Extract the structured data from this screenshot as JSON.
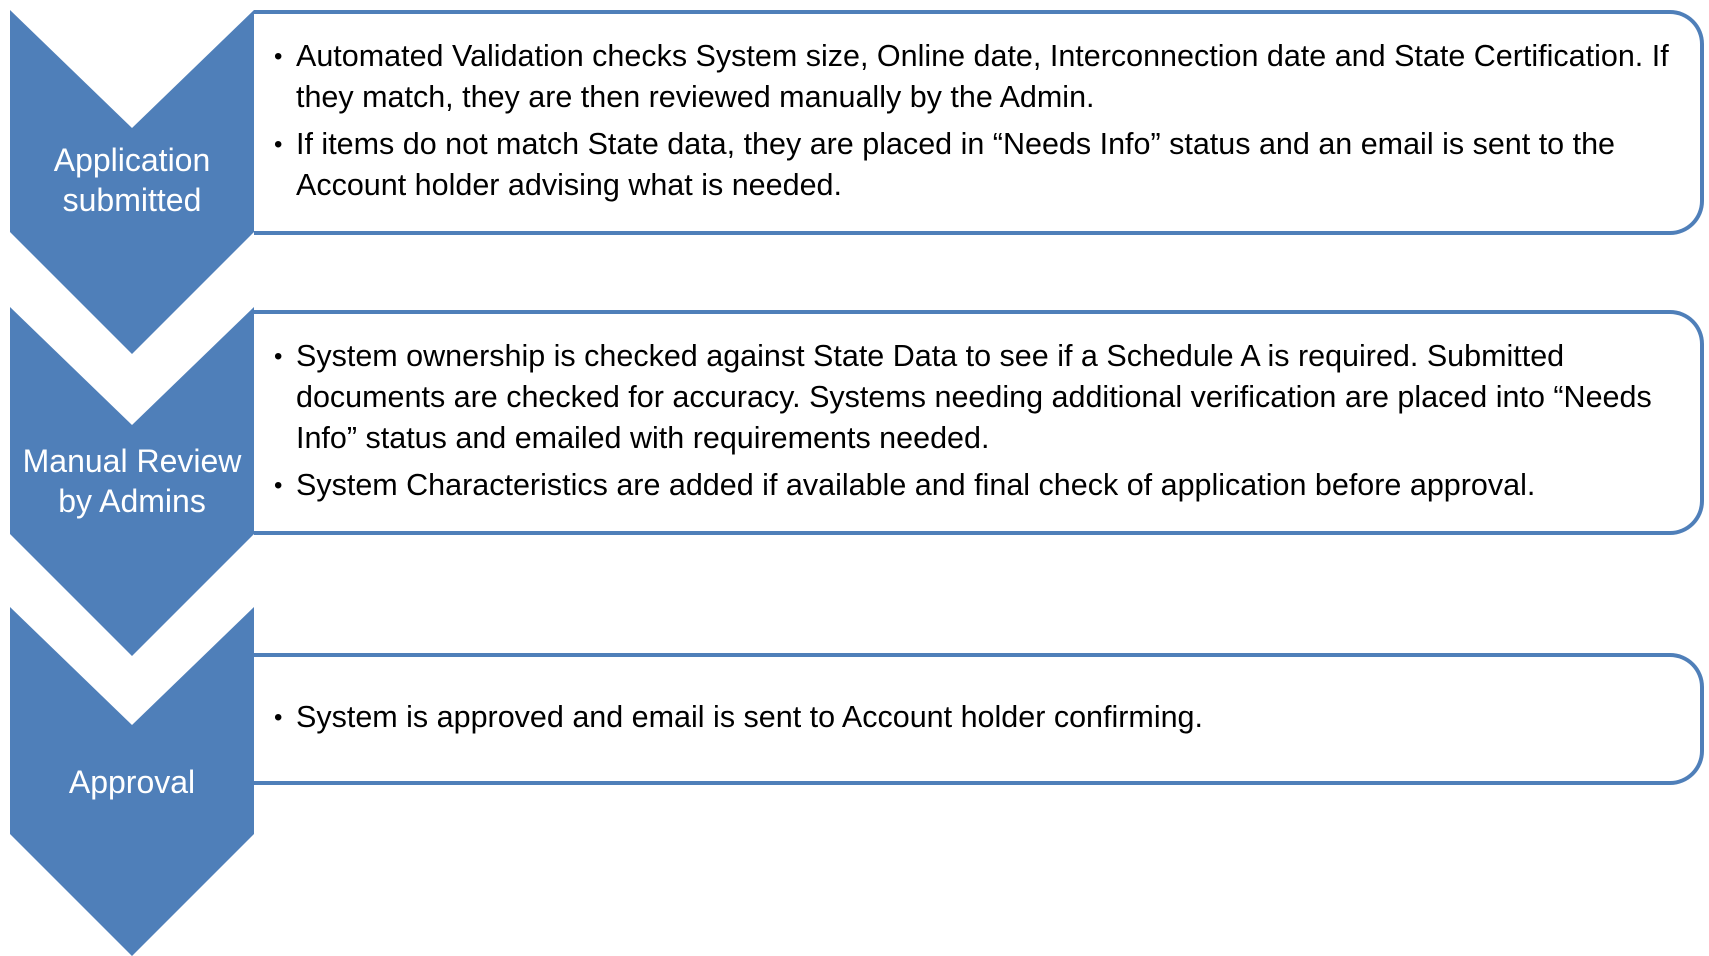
{
  "colors": {
    "chevron_fill": "#4f7fb9",
    "box_border": "#4f7fb9",
    "label_text": "#ffffff",
    "body_text": "#000000"
  },
  "steps": [
    {
      "label": "Application\nsubmitted",
      "bullets": [
        "Automated Validation checks System size, Online date, Interconnection date and State Certification.  If they match, they are then reviewed manually by the Admin.",
        "If items do not match State data, they are placed in “Needs Info” status and an email is sent to the Account holder advising what is needed."
      ]
    },
    {
      "label": "Manual Review\nby Admins",
      "bullets": [
        "System ownership is checked against State Data to see if a Schedule A is required.  Submitted documents are checked  for accuracy.  Systems needing additional verification are placed into “Needs Info” status and emailed with requirements needed.",
        "System Characteristics are added if available and final check of application before approval."
      ]
    },
    {
      "label": "Approval",
      "bullets": [
        "System is approved and email is sent to Account holder confirming."
      ]
    }
  ]
}
